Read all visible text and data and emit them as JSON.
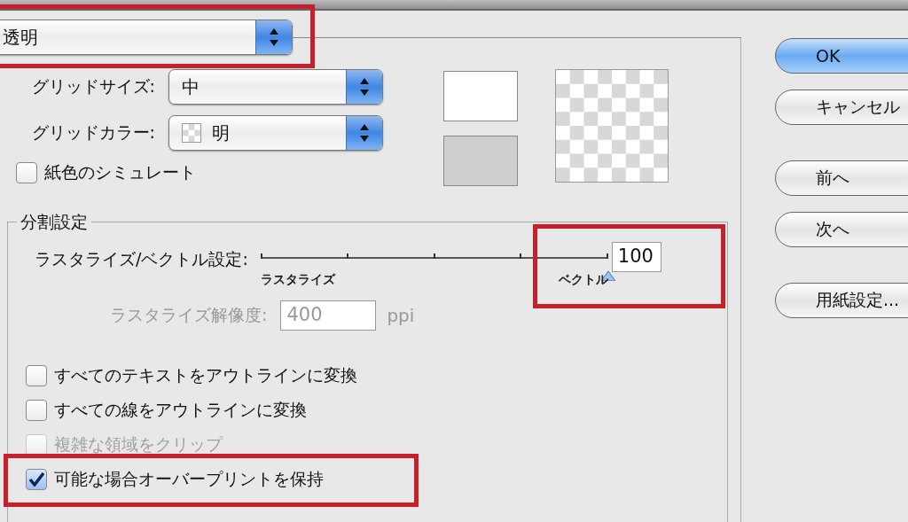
{
  "mode_dropdown": {
    "value": "透明",
    "highlighted": true
  },
  "grid_size": {
    "label": "グリッドサイズ:",
    "value": "中"
  },
  "grid_color": {
    "label": "グリッドカラー:",
    "value": "明"
  },
  "simulate_paper": {
    "label": "紙色のシミュレート",
    "checked": false
  },
  "flattener": {
    "title": "分割設定",
    "slider": {
      "label": "ラスタライズ/ベクトル設定:",
      "level": 1,
      "value": "100",
      "min_label": "ラスタライズ",
      "max_label": "ベクトル",
      "highlighted": true
    },
    "resolution": {
      "label": "ラスタライズ解像度:",
      "value": "400",
      "unit": "ppi",
      "disabled": true
    },
    "options": [
      {
        "label": "すべてのテキストをアウトラインに変換",
        "checked": false,
        "disabled": false,
        "highlighted": false
      },
      {
        "label": "すべての線をアウトラインに変換",
        "checked": false,
        "disabled": false,
        "highlighted": false
      },
      {
        "label": "複雑な領域をクリップ",
        "checked": false,
        "disabled": true,
        "highlighted": false
      },
      {
        "label": "可能な場合オーバープリントを保持",
        "checked": true,
        "disabled": false,
        "highlighted": true
      }
    ]
  },
  "button_groups": [
    [
      {
        "label": "OK",
        "default": true
      },
      {
        "label": "キャンセル",
        "default": false
      }
    ],
    [
      {
        "label": "前へ",
        "default": false
      },
      {
        "label": "次へ",
        "default": false
      }
    ],
    [
      {
        "label": "用紙設定...",
        "default": false
      }
    ]
  ]
}
